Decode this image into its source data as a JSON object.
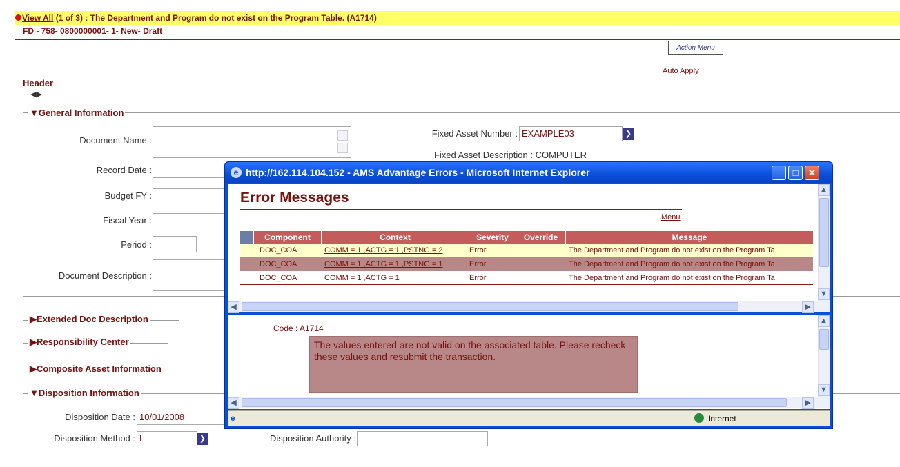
{
  "error_bar": {
    "link": "View All",
    "text": " (1 of 3) : The Department and Program do not exist on the Program Table. (A1714)"
  },
  "document_id": "FD - 758- 0800000001- 1- New- Draft",
  "action_menu": "Action Menu",
  "auto_apply": "Auto Apply",
  "header_label": "Header",
  "sections": {
    "general": "General Information",
    "extended": "Extended Doc Description",
    "responsibility": "Responsibility Center",
    "composite": "Composite Asset Information",
    "disposition": "Disposition Information"
  },
  "fields": {
    "document_name": "Document Name :",
    "record_date": "Record Date :",
    "budget_fy": "Budget FY :",
    "fiscal_year": "Fiscal Year :",
    "period": "Period :",
    "document_description": "Document Description :",
    "fixed_asset_number_label": "Fixed Asset Number :",
    "fixed_asset_number_value": "EXAMPLE03",
    "fixed_asset_description": "Fixed Asset Description : COMPUTER",
    "disposition_date_label": "Disposition Date :",
    "disposition_date_value": "10/01/2008",
    "disposition_method_label": "Disposition Method :",
    "disposition_method_value": "L",
    "disposition_authority_label": "Disposition Authority :"
  },
  "popup": {
    "title": "http://162.114.104.152 - AMS Advantage Errors - Microsoft Internet Explorer",
    "heading": "Error Messages",
    "menu": "Menu",
    "columns": [
      "Component",
      "Context",
      "Severity",
      "Override",
      "Message"
    ],
    "rows": [
      {
        "component": "DOC_COA",
        "context": "COMM = 1 ,ACTG = 1 ,PSTNG = 2",
        "severity": "Error",
        "override": "",
        "message": "The Department and Program do not exist on the Program Ta"
      },
      {
        "component": "DOC_COA",
        "context": "COMM = 1 ,ACTG = 1 ,PSTNG = 1",
        "severity": "Error",
        "override": "",
        "message": "The Department and Program do not exist on the Program Ta"
      },
      {
        "component": "DOC_COA",
        "context": "COMM = 1 ,ACTG = 1",
        "severity": "Error",
        "override": "",
        "message": "The Department and Program do not exist on the Program Ta"
      }
    ],
    "code": "Code : A1714",
    "detail": "The values entered are not valid on the associated table. Please recheck these values and resubmit the transaction.",
    "status_zone": "Internet"
  },
  "colors": {
    "brand_maroon": "#7a1010",
    "error_bar": "#ffff66",
    "table_header": "#c45c5c",
    "selected_row": "#b88888",
    "highlight_row": "#ffffcc",
    "titlebar": "#0a4fd8"
  }
}
